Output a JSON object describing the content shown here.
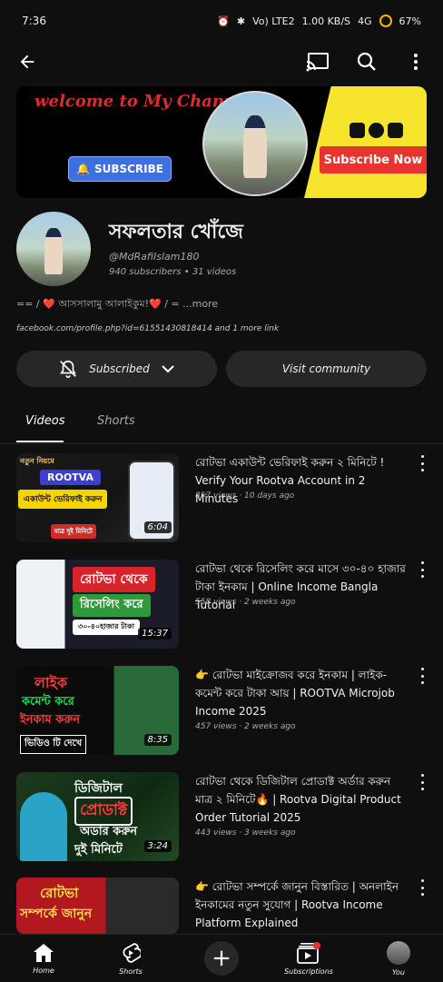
{
  "status": {
    "time": "7:36",
    "network": "Vo) LTE2",
    "net_speed": "1.00 KB/S",
    "signal": "4G",
    "battery": "67%"
  },
  "header": {
    "back": "back",
    "cast": "cast",
    "search": "search",
    "more": "more"
  },
  "banner": {
    "title": "welcome to My Channel",
    "subscribe_button": "SUBSCRIBE",
    "subscribe_now": "Subscribe Now"
  },
  "channel": {
    "name": "সফলতার খোঁজে",
    "handle": "@MdRafiIslam180",
    "meta": "940 subscribers • 31 videos",
    "description": "== / ❤️ আসসালামু আলাইকুম!❤️ / = ...more",
    "link": "facebook.com/profile.php?id=61551430818414 and 1 more link",
    "subscribed_label": "Subscribed",
    "visit_label": "Visit community"
  },
  "tabs": {
    "videos": "Videos",
    "shorts": "Shorts"
  },
  "videos": [
    {
      "title": "রোটভা একাউন্ট ভেরিফাই করুন ২ মিনিটে ! Verify Your Rootva Account in 2 Minutes",
      "meta": "857 views · 10 days ago",
      "duration": "6:04",
      "thumb_labels": [
        "নতুন নিয়মে",
        "ROOTVA",
        "একাউন্ট ভেরিফাই করুন",
        "মাত্র দুই মিনিটে"
      ]
    },
    {
      "title": "রোটভা থেকে রিসেলিং করে মাসে ৩০-৪০ হাজার টাকা ইনকাম | Online Income Bangla Tutorial",
      "meta": "558 views · 2 weeks ago",
      "duration": "15:37",
      "thumb_labels": [
        "রোটভা থেকে",
        "রিসেলিং করে",
        "৩০-৪০হাজার টাকা"
      ]
    },
    {
      "title": "👉 রোটভা মাইক্রোজব করে ইনকাম | লাইক-কমেন্ট করে টাকা আয় | ROOTVA Microjob Income 2025",
      "meta": "457 views · 2 weeks ago",
      "duration": "8:35",
      "thumb_labels": [
        "লাইক",
        "কমেন্ট করে",
        "ইনকাম করুন",
        "ভিডিও টি দেখে"
      ]
    },
    {
      "title": "রোটভা থেকে ডিজিটাল প্রোডাক্ট অর্ডার করুন মাত্র ২ মিনিটে🔥 | Rootva Digital Product Order Tutorial 2025",
      "meta": "443 views · 3 weeks ago",
      "duration": "3:24",
      "thumb_labels": [
        "ডিজিটাল",
        "প্রোডাক্ট",
        "অডার করুন",
        "দুই মিনিটে"
      ]
    },
    {
      "title": "👉 রোটভা সম্পর্কে জানুন বিস্তারিত | অনলাইন ইনকামের নতুন সুযোগ | Rootva Income Platform Explained",
      "meta": "",
      "duration": "",
      "thumb_labels": [
        "রোটভা",
        "সম্পর্কে জানুন"
      ]
    }
  ],
  "nav": {
    "home": "Home",
    "shorts": "Shorts",
    "create": "create",
    "subscriptions": "Subscriptions",
    "you": "You"
  },
  "colors": {
    "bg": "#0f0f0f",
    "accent_red": "#e8342f",
    "yellow": "#f6e52c"
  }
}
